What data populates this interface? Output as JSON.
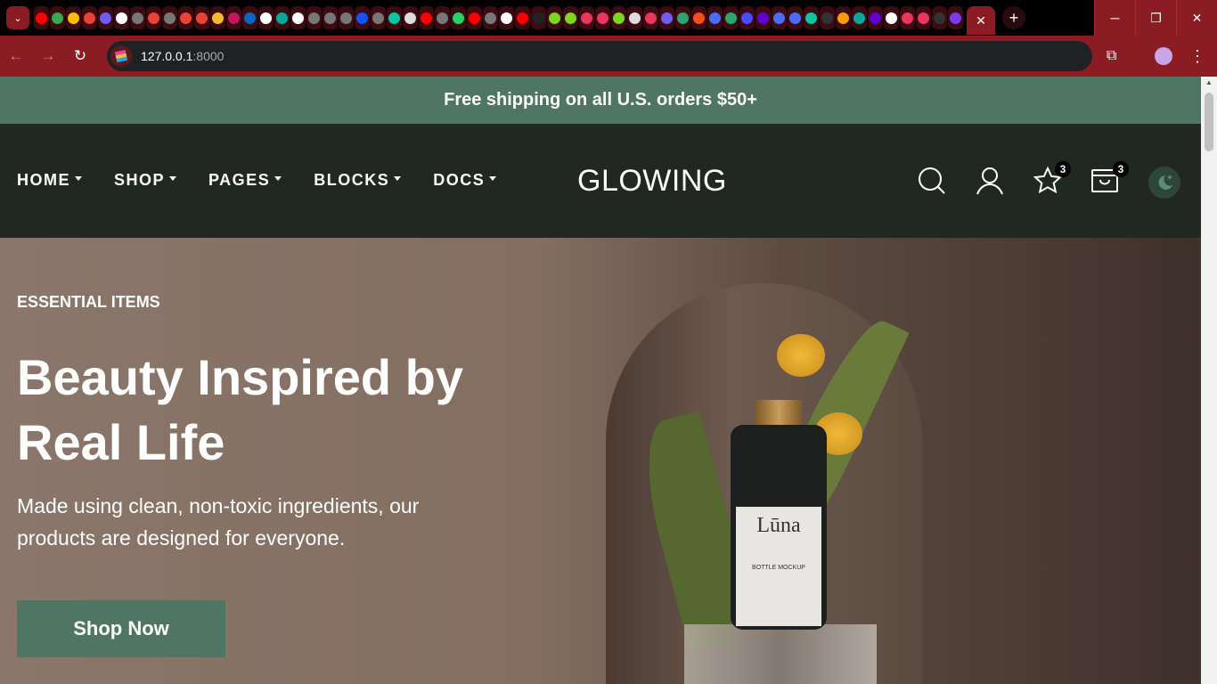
{
  "browser": {
    "tab_favicons": [
      "youtube",
      "google-drive",
      "google-drive",
      "gmail",
      "meta",
      "google",
      "globe",
      "gmail",
      "globe",
      "gmail",
      "gmail",
      "binance",
      "app",
      "linkedin",
      "github",
      "diamond",
      "github",
      "globe",
      "globe",
      "globe",
      "coinmarketcap",
      "globe",
      "q-app",
      "bug",
      "youtube",
      "globe",
      "whatsapp",
      "youtube",
      "globe",
      "github",
      "youtube",
      "square",
      "leaf",
      "leaf",
      "swirl",
      "swirl",
      "leaf",
      "openai",
      "swirl",
      "meta",
      "fn",
      "figma",
      "square",
      "fn",
      "api",
      "yahoo",
      "swirl",
      "swirl",
      "q-app",
      "globe",
      "sailboat",
      "diamond",
      "yahoo",
      "triangle",
      "swirl",
      "swirl",
      "dark",
      "bootstrap"
    ],
    "favicon_colors": [
      "#ff0000",
      "#34a853",
      "#fbbc04",
      "#ea4335",
      "#6f5cf0",
      "#ffffff",
      "#777777",
      "#ea4335",
      "#777777",
      "#ea4335",
      "#ea4335",
      "#f3ba2f",
      "#c2185b",
      "#0a66c2",
      "#ffffff",
      "#0aa89b",
      "#ffffff",
      "#777777",
      "#777777",
      "#777777",
      "#1652f0",
      "#777777",
      "#0cc4a0",
      "#dddddd",
      "#ff0000",
      "#777777",
      "#25d366",
      "#ff0000",
      "#777777",
      "#ffffff",
      "#ff0000",
      "#222222",
      "#7ed321",
      "#7ed321",
      "#e8365d",
      "#e8365d",
      "#7ed321",
      "#dddddd",
      "#e8365d",
      "#6f5cf0",
      "#2ea36f",
      "#f24e1e",
      "#4a6cf7",
      "#2ea36f",
      "#4a4aff",
      "#6001d2",
      "#4a6cf7",
      "#4a6cf7",
      "#0cc4a0",
      "#333333",
      "#f59e0b",
      "#0aa89b",
      "#6001d2",
      "#ffffff",
      "#e8365d",
      "#e8365d",
      "#333333",
      "#7c3aed"
    ],
    "active_tab_close": "✕",
    "new_tab": "+",
    "url_host": "127.0.0.1",
    "url_port": ":8000",
    "window_controls": {
      "minimize": "─",
      "restore": "❐",
      "close": "✕"
    }
  },
  "announcement": "Free shipping on all U.S. orders $50+",
  "header": {
    "menu": [
      "HOME",
      "SHOP",
      "PAGES",
      "BLOCKS",
      "DOCS"
    ],
    "logo": "GLOWING",
    "wishlist_count": "3",
    "cart_count": "3"
  },
  "hero": {
    "eyebrow": "ESSENTIAL ITEMS",
    "title": "Beauty Inspired by Real Life",
    "subtitle": "Made using clean, non-toxic ingredients, our products are designed for everyone.",
    "cta": "Shop Now",
    "product_brand": "Lūna",
    "product_label": "BOTTLE MOCKUP"
  },
  "colors": {
    "brand_green": "#4f7563",
    "header_bg": "#212822",
    "browser_accent": "#8b1c24"
  }
}
